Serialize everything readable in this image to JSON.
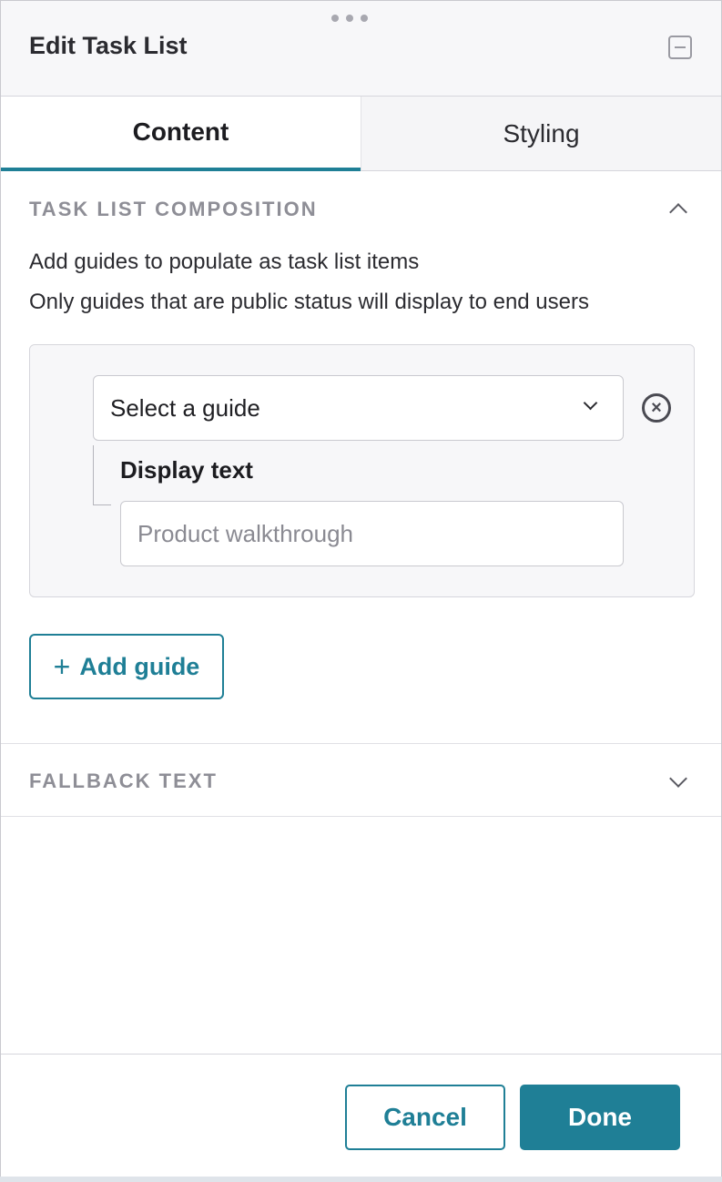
{
  "header": {
    "title": "Edit Task List"
  },
  "tabs": [
    {
      "label": "Content",
      "active": true
    },
    {
      "label": "Styling",
      "active": false
    }
  ],
  "composition": {
    "section_title": "TASK LIST COMPOSITION",
    "description_line1": "Add guides to populate as task list items",
    "description_line2": "Only guides that are public status will display to end users",
    "guide_select": {
      "selected": "Select a guide"
    },
    "remove_icon_glyph": "×",
    "display_text": {
      "label": "Display text",
      "placeholder": "Product walkthrough",
      "value": ""
    },
    "add_guide": {
      "icon": "+",
      "label": "Add guide"
    }
  },
  "fallback": {
    "section_title": "FALLBACK TEXT"
  },
  "footer": {
    "cancel_label": "Cancel",
    "done_label": "Done"
  },
  "colors": {
    "accent": "#1f7f96",
    "section_title": "#8e8e96",
    "header_bg": "#f7f7f9"
  },
  "icons": {
    "drag": "drag-handle-icon",
    "minimize": "minimize-icon",
    "collapse": "chevron-up-icon",
    "expand": "chevron-down-icon",
    "remove": "remove-circle-icon",
    "add": "plus-icon"
  }
}
